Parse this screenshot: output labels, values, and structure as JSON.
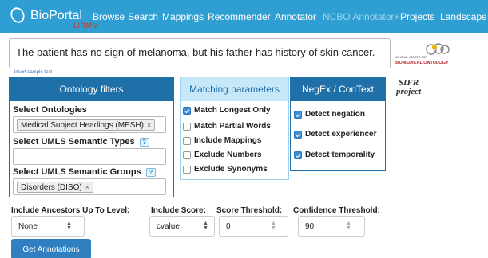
{
  "nav": {
    "brand": "BioPortal",
    "brand_sub": "LIRMM",
    "items": [
      "Browse",
      "Search",
      "Mappings",
      "Recommender",
      "Annotator",
      "NCBO Annotator+",
      "Projects",
      "Landscape"
    ]
  },
  "input": {
    "text": "The patient has no sign of melanoma, but his father has history of skin cancer.",
    "insert_sample": "insert sample text"
  },
  "logos": {
    "ncbo_small": "NATIONAL CENTER FOR",
    "ncbo_big": "BIOMEDICAL ONTOLOGY",
    "sifr_line1": "SIFR",
    "sifr_line2": "project"
  },
  "ontology_filters": {
    "header": "Ontology filters",
    "select_ontologies_label": "Select Ontologies",
    "ontology_tag": "Medical Subject Headings (MESH)",
    "semantic_types_label": "Select UMLS Semantic Types",
    "semantic_groups_label": "Select UMLS Semantic Groups",
    "group_tag": "Disorders (DISO)",
    "help_glyph": "?",
    "remove_glyph": "×"
  },
  "matching": {
    "header": "Matching parameters",
    "options": [
      {
        "label": "Match Longest Only",
        "checked": true
      },
      {
        "label": "Match Partial Words",
        "checked": false
      },
      {
        "label": "Include Mappings",
        "checked": false
      },
      {
        "label": "Exclude Numbers",
        "checked": false
      },
      {
        "label": "Exclude Synonyms",
        "checked": false
      }
    ]
  },
  "negex": {
    "header": "NegEx / ConText",
    "options": [
      {
        "label": "Detect negation",
        "checked": true
      },
      {
        "label": "Detect experiencer",
        "checked": true
      },
      {
        "label": "Detect temporality",
        "checked": true
      }
    ]
  },
  "bottom": {
    "ancestors_label": "Include Ancestors Up To Level:",
    "ancestors_value": "None",
    "score_label": "Include Score:",
    "score_value": "cvalue",
    "threshold_label": "Score Threshold:",
    "threshold_value": "0",
    "confidence_label": "Confidence Threshold:",
    "confidence_value": "90",
    "submit": "Get Annotations"
  },
  "colors": {
    "navbar": "#2f9fd3",
    "panel_header_dark": "#1f6fa8",
    "panel_header_light": "#c7e8f8",
    "button": "#2f7fc1",
    "checkbox_on": "#3c8fd6"
  }
}
